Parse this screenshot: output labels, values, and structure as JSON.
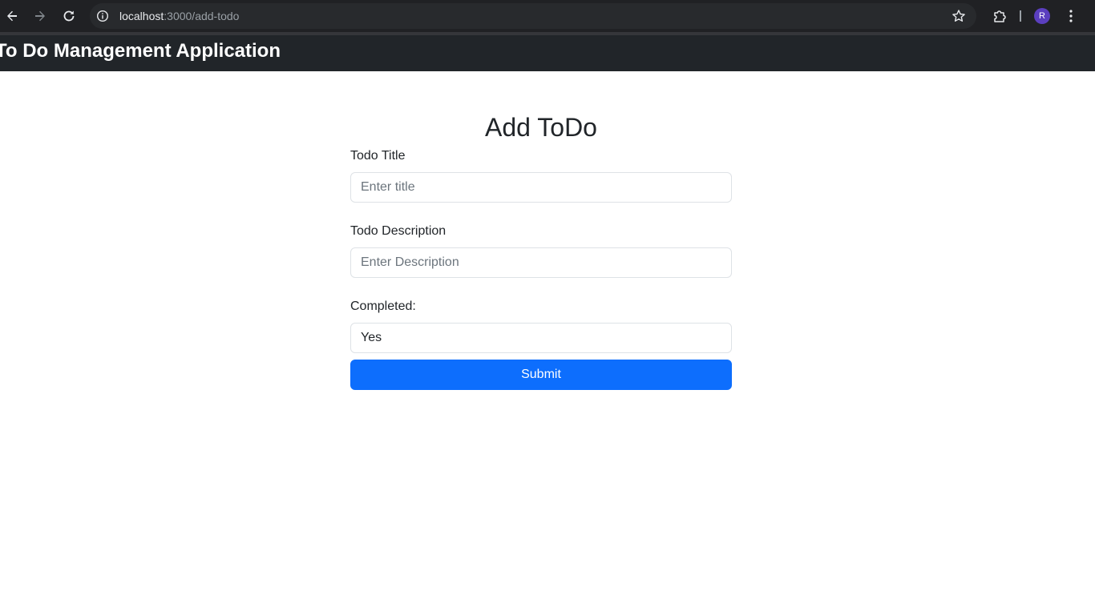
{
  "browser": {
    "url_host": "localhost",
    "url_rest": ":3000/add-todo",
    "profile_initial": "R"
  },
  "navbar": {
    "brand": "To Do Management Application"
  },
  "form": {
    "title": "Add ToDo",
    "title_field": {
      "label": "Todo Title",
      "placeholder": "Enter title",
      "value": ""
    },
    "description_field": {
      "label": "Todo Description",
      "placeholder": "Enter Description",
      "value": ""
    },
    "completed_field": {
      "label": "Completed:",
      "selected": "Yes"
    },
    "submit_label": "Submit"
  },
  "colors": {
    "navbar_bg": "#212529",
    "primary": "#0d6efd"
  },
  "icons": [
    "back-arrow-icon",
    "forward-arrow-icon",
    "reload-icon",
    "site-info-icon",
    "bookmark-star-icon",
    "extensions-icon",
    "more-menu-icon"
  ]
}
